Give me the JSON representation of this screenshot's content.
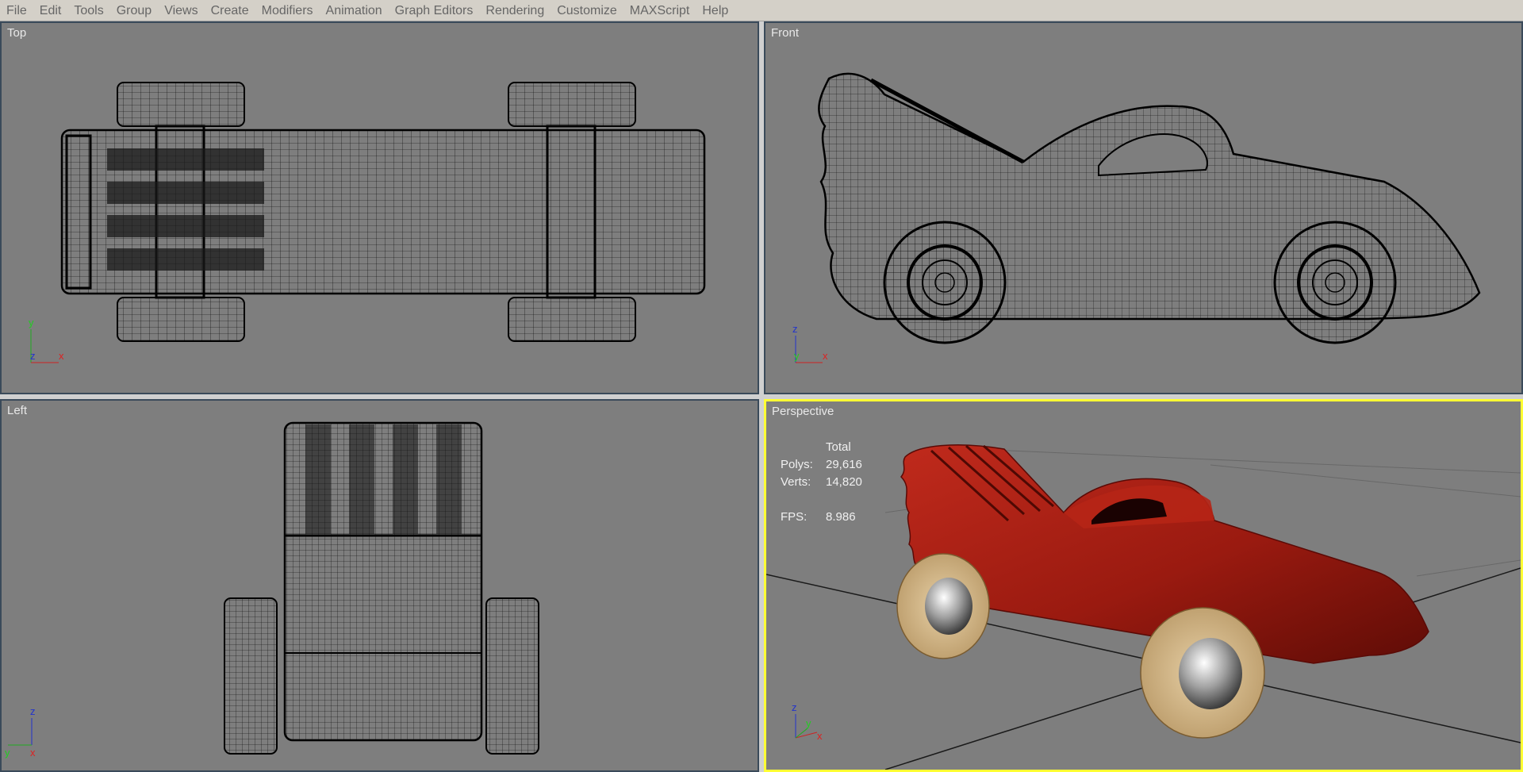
{
  "menu": [
    "File",
    "Edit",
    "Tools",
    "Group",
    "Views",
    "Create",
    "Modifiers",
    "Animation",
    "Graph Editors",
    "Rendering",
    "Customize",
    "MAXScript",
    "Help"
  ],
  "viewports": {
    "top": {
      "label": "Top",
      "axes": [
        "y",
        "z",
        "x"
      ]
    },
    "front": {
      "label": "Front",
      "axes": [
        "z",
        "y",
        "x"
      ]
    },
    "left": {
      "label": "Left",
      "axes": [
        "z",
        "y",
        "x"
      ]
    },
    "perspective": {
      "label": "Perspective",
      "axes": [
        "z",
        "y",
        "x"
      ]
    }
  },
  "stats": {
    "header": "Total",
    "polys_label": "Polys:",
    "polys_value": "29,616",
    "verts_label": "Verts:",
    "verts_value": "14,820",
    "fps_label": "FPS:",
    "fps_value": "8.986"
  },
  "colors": {
    "viewport_bg": "#7e7e7e",
    "active_border": "#ffff33",
    "car_body": "#a51d12",
    "wheel_wood": "#d8bd8e",
    "wireframe": "#000000"
  }
}
